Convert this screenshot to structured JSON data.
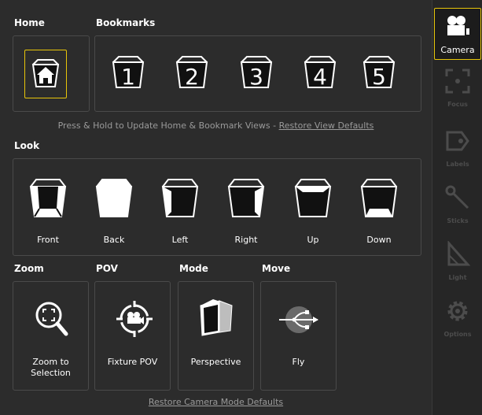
{
  "sections": {
    "home": "Home",
    "bookmarks": "Bookmarks",
    "look": "Look",
    "zoom": "Zoom",
    "pov": "POV",
    "mode": "Mode",
    "move": "Move"
  },
  "bookmarks": [
    "1",
    "2",
    "3",
    "4",
    "5"
  ],
  "hint": {
    "text": "Press & Hold to Update Home & Bookmark Views - ",
    "link": "Restore View Defaults"
  },
  "look": [
    "Front",
    "Back",
    "Left",
    "Right",
    "Up",
    "Down"
  ],
  "tiles": {
    "zoom": "Zoom to Selection",
    "pov": "Fixture POV",
    "mode": "Perspective",
    "move": "Fly"
  },
  "footer_link": "Restore Camera Mode Defaults",
  "sidebar": [
    {
      "label": "Camera",
      "icon": "camera-icon",
      "active": true
    },
    {
      "label": "Focus",
      "icon": "focus-icon",
      "active": false
    },
    {
      "label": "Labels",
      "icon": "labels-icon",
      "active": false
    },
    {
      "label": "Sticks",
      "icon": "sticks-icon",
      "active": false
    },
    {
      "label": "Light",
      "icon": "light-icon",
      "active": false
    },
    {
      "label": "Options",
      "icon": "gear-icon",
      "active": false
    }
  ],
  "colors": {
    "accent": "#e8c60a",
    "background": "#2c2c2c",
    "text": "#ffffff"
  }
}
